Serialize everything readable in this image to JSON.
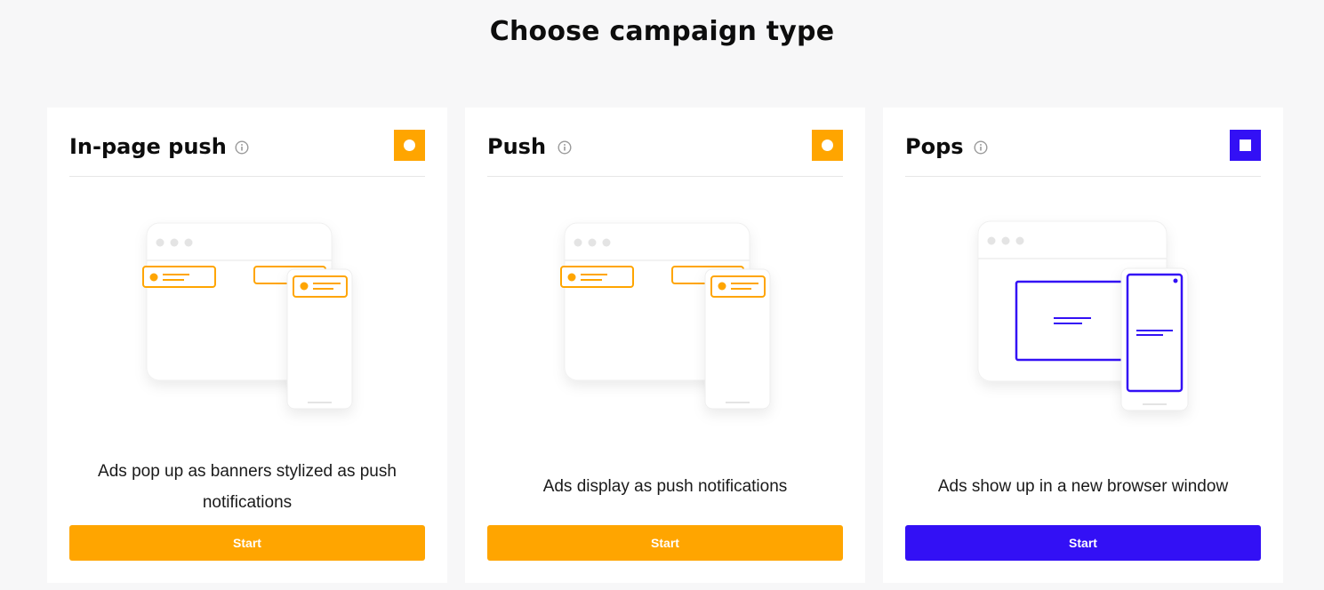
{
  "page": {
    "title": "Choose campaign type"
  },
  "colors": {
    "orange": "#ffa500",
    "purple": "#3310f5"
  },
  "cards": [
    {
      "title": "In-page push",
      "description": "Ads pop up as banners stylized as push notifications",
      "button_label": "Start",
      "accent": "#ffa500",
      "selector_icon": "circle"
    },
    {
      "title": "Push",
      "description": "Ads display as push notifications",
      "button_label": "Start",
      "accent": "#ffa500",
      "selector_icon": "circle"
    },
    {
      "title": "Pops",
      "description": "Ads show up in a new browser window",
      "button_label": "Start",
      "accent": "#3310f5",
      "selector_icon": "square"
    }
  ]
}
